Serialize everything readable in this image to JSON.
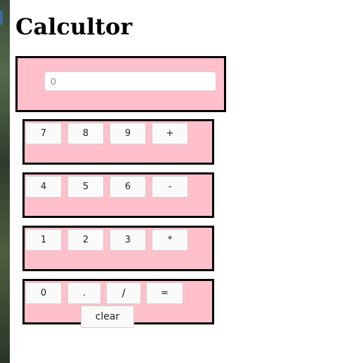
{
  "page": {
    "title": "Calcultor"
  },
  "display": {
    "placeholder": "0",
    "value": ""
  },
  "keypad": {
    "row1": [
      "7",
      "8",
      "9",
      "+"
    ],
    "row2": [
      "4",
      "5",
      "6",
      "-"
    ],
    "row3": [
      "1",
      "2",
      "3",
      "*"
    ],
    "row4": [
      "0",
      ".",
      "/",
      "="
    ],
    "clear_label": "clear"
  },
  "colors": {
    "panel_background": "#ffc0cb",
    "panel_border": "#000000",
    "button_background": "#fafafa"
  }
}
